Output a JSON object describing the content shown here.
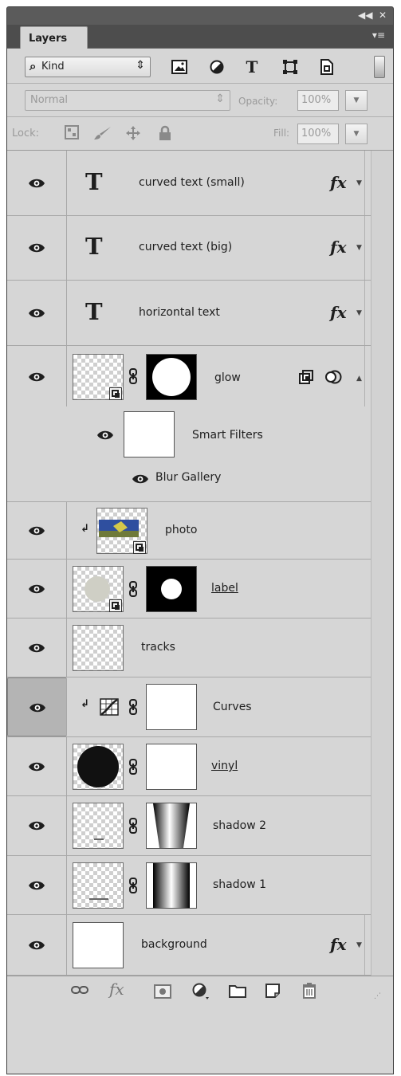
{
  "window": {
    "collapse_glyph": "◀◀",
    "close_glyph": "✕"
  },
  "panel": {
    "tab_label": "Layers",
    "menu_glyph": "▾≡"
  },
  "filter": {
    "kind_label": "Kind",
    "kind_search_glyph": "⌕",
    "arrows_glyph": "⇕",
    "icons": [
      "image-filter-icon",
      "adjustment-filter-icon",
      "type-filter-icon",
      "shape-filter-icon",
      "smart-object-filter-icon"
    ],
    "type_icon_glyph": "T",
    "shape_icon_glyph": "⌗"
  },
  "blend": {
    "mode_label": "Normal",
    "opacity_label": "Opacity:",
    "opacity_value": "100%",
    "dropdown_glyph": "▼"
  },
  "lock": {
    "lock_label": "Lock:",
    "fill_label": "Fill:",
    "fill_value": "100%",
    "icons": [
      "lock-transparent-pixels-icon",
      "lock-image-pixels-icon",
      "lock-position-icon",
      "lock-all-icon"
    ]
  },
  "layers": [
    {
      "name": "curved text (small)",
      "kind": "text",
      "has_fx": true
    },
    {
      "name": "curved text (big)",
      "kind": "text",
      "has_fx": true
    },
    {
      "name": "horizontal text",
      "kind": "text",
      "has_fx": true
    },
    {
      "name": "glow",
      "kind": "smart-object",
      "has_mask": true
    },
    {
      "name": "photo",
      "kind": "smart-object",
      "clipped": true
    },
    {
      "name": "label",
      "kind": "smart-object",
      "has_mask": true,
      "underlined": true
    },
    {
      "name": "tracks",
      "kind": "pixel"
    },
    {
      "name": "Curves",
      "kind": "adjustment",
      "clipped": true,
      "selected": true
    },
    {
      "name": "vinyl",
      "kind": "pixel",
      "has_mask": true,
      "underlined": true
    },
    {
      "name": "shadow 2",
      "kind": "pixel",
      "has_mask": true
    },
    {
      "name": "shadow 1",
      "kind": "pixel",
      "has_mask": true
    },
    {
      "name": "background",
      "kind": "pixel",
      "has_fx": true
    }
  ],
  "smart_filters": {
    "label": "Smart Filters",
    "filter_name": "Blur Gallery"
  },
  "glyphs": {
    "type_layer": "T",
    "fx": "fx",
    "fx_arrow": "▼",
    "collapse_arrow": "▲",
    "clip_arrow": "↲"
  },
  "footer": {
    "icons": [
      "link-layers-icon",
      "add-layer-style-icon",
      "add-mask-icon",
      "new-adjustment-layer-icon",
      "new-group-icon",
      "new-layer-icon",
      "delete-layer-icon"
    ],
    "fx_glyph": "fx"
  },
  "colors": {
    "panel_bg": "#d6d6d6",
    "header_bg": "#5b5b5b",
    "selected_eye_bg": "#b4b4b4",
    "glow_mask": "#000000",
    "photo_accent": "#2f4f9f"
  }
}
